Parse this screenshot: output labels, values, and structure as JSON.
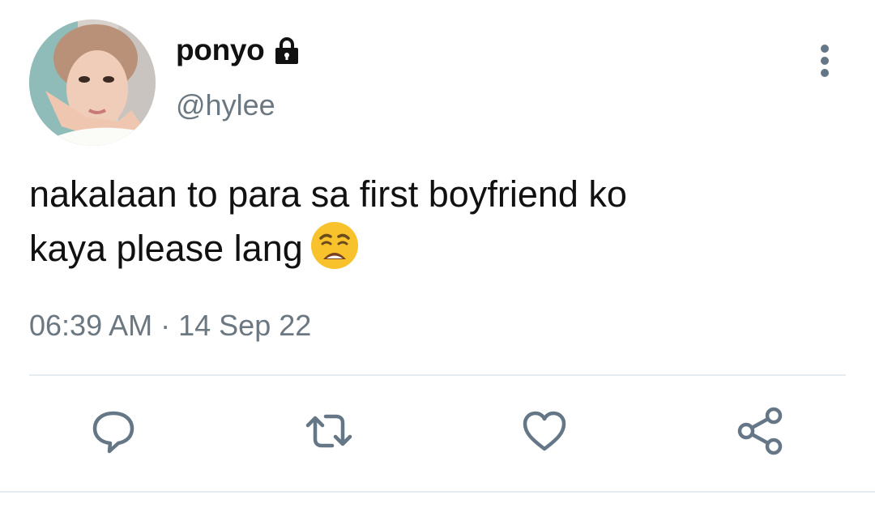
{
  "tweet": {
    "display_name": "ponyo",
    "handle": "@hylee",
    "text_lines": [
      "nakalaan to para sa first boyfriend ko",
      "kaya please lang"
    ],
    "time": "06:39 AM",
    "separator": " · ",
    "date": "14 Sep 22"
  },
  "icons": {
    "account": "lock-icon",
    "menu": "more-vertical-icon",
    "emoji": "weary-face-emoji",
    "actions": [
      "reply-icon",
      "retweet-icon",
      "like-icon",
      "share-icon"
    ]
  },
  "colors": {
    "text": "#111111",
    "muted": "#6b7781",
    "icon": "#657786",
    "divider": "#e6ecf0",
    "emoji": "#f7c22c"
  }
}
